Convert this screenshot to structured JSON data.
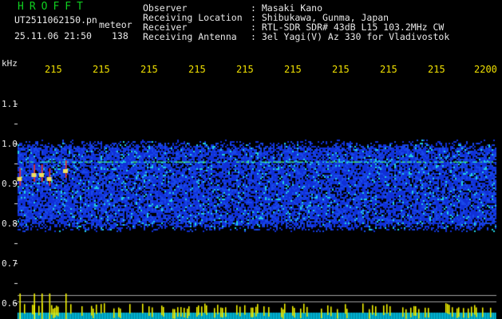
{
  "station": {
    "logo": "HROFFT",
    "file": "UT2511062150.pn",
    "tag": "meteor",
    "datetime": "25.11.06 21:50",
    "count": "138"
  },
  "info": {
    "labels": [
      "Observer",
      "Receiving Location",
      "Receiver",
      "Receiving Antenna"
    ],
    "values": [
      ": Masaki Kano",
      ": Shibukawa, Gunma, Japan",
      ": RTL-SDR SDR# 43dB L15 103.2MHz CW",
      ": 3el Yagi(V) Az 330 for Vladivostok"
    ]
  },
  "chart_data": {
    "type": "heatmap",
    "ylabel": "kHz",
    "y_ticks": [
      "1.1",
      "1.0",
      "0.9",
      "0.8",
      "0.7",
      "0.6"
    ],
    "x_ticks": [
      "215",
      "215",
      "215",
      "215",
      "215",
      "215",
      "215",
      "215",
      "215",
      "2200"
    ],
    "ylim": [
      0.58,
      1.13
    ],
    "x_minutes": [
      2150,
      2200
    ],
    "noise_band_khz": [
      0.78,
      1.01
    ],
    "carrier_khz": 0.955,
    "meteor_echoes": [
      {
        "time": 2150.2,
        "khz": 0.91
      },
      {
        "time": 2151.7,
        "khz": 0.92
      },
      {
        "time": 2152.5,
        "khz": 0.92
      },
      {
        "time": 2153.3,
        "khz": 0.91
      },
      {
        "time": 2155.0,
        "khz": 0.93
      }
    ],
    "colors": {
      "background": "#000000",
      "noise_low": "#1030d8",
      "noise_high": "#20d0e0",
      "carrier": "#40e070",
      "echo": "#ff3020",
      "power_bar": "#00d8ff",
      "spike": "#ffff00",
      "ylabel": "#e8e8e8",
      "xlabel": "#f0e000",
      "title": "#10d020"
    }
  }
}
